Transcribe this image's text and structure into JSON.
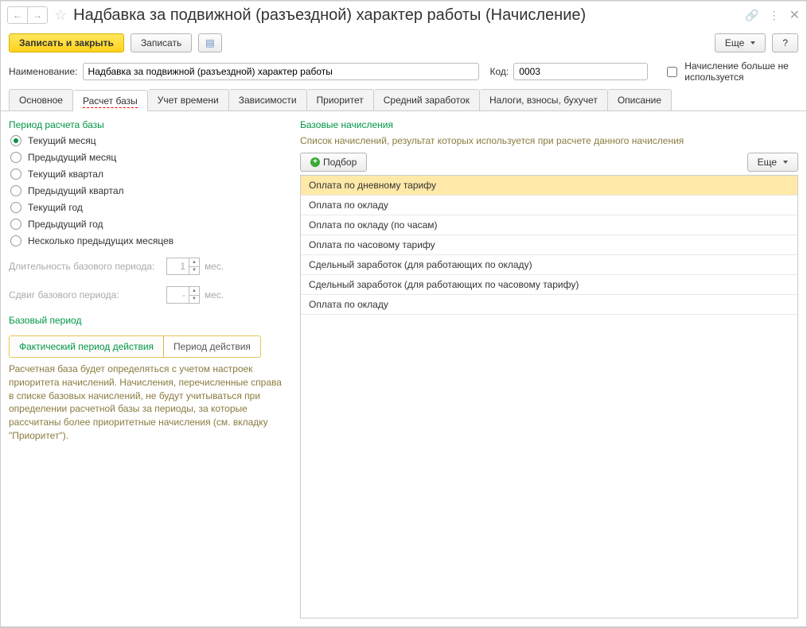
{
  "title": "Надбавка за подвижной (разъездной) характер работы (Начисление)",
  "cmdbar": {
    "save_close": "Записать и закрыть",
    "save": "Записать",
    "more": "Еще",
    "help": "?"
  },
  "form": {
    "name_label": "Наименование:",
    "name_value": "Надбавка за подвижной (разъездной) характер работы",
    "code_label": "Код:",
    "code_value": "0003",
    "unused_label": "Начисление больше не используется"
  },
  "tabs": {
    "t1": "Основное",
    "t2": "Расчет базы",
    "t3": "Учет времени",
    "t4": "Зависимости",
    "t5": "Приоритет",
    "t6": "Средний заработок",
    "t7": "Налоги, взносы, бухучет",
    "t8": "Описание"
  },
  "period": {
    "title": "Период расчета базы",
    "opts": {
      "o1": "Текущий месяц",
      "o2": "Предыдущий месяц",
      "o3": "Текущий квартал",
      "o4": "Предыдущий квартал",
      "o5": "Текущий год",
      "o6": "Предыдущий год",
      "o7": "Несколько предыдущих месяцев"
    },
    "dur_label": "Длительность базового периода:",
    "dur_value": "1",
    "dur_unit": "мес.",
    "shift_label": "Сдвиг базового периода:",
    "shift_value": "-",
    "shift_unit": "мес."
  },
  "base_period": {
    "title": "Базовый период",
    "opt1": "Фактический период действия",
    "opt2": "Период действия",
    "help": "Расчетная база будет определяться с учетом настроек приоритета начислений. Начисления, перечисленные справа в списке базовых начислений, не будут учитываться при определении расчетной базы за периоды, за которые рассчитаны более приоритетные начисления (см. вкладку \"Приоритет\")."
  },
  "base_calc": {
    "title": "Базовые начисления",
    "desc": "Список начислений, результат которых используется при расчете данного начисления",
    "pick": "Подбор",
    "more": "Еще",
    "rows": {
      "r1": "Оплата по дневному тарифу",
      "r2": "Оплата по окладу",
      "r3": "Оплата по окладу (по часам)",
      "r4": "Оплата по часовому тарифу",
      "r5": "Сдельный заработок (для работающих по окладу)",
      "r6": "Сдельный заработок (для работающих по часовому тарифу)",
      "r7": "Оплата по окладу"
    }
  }
}
